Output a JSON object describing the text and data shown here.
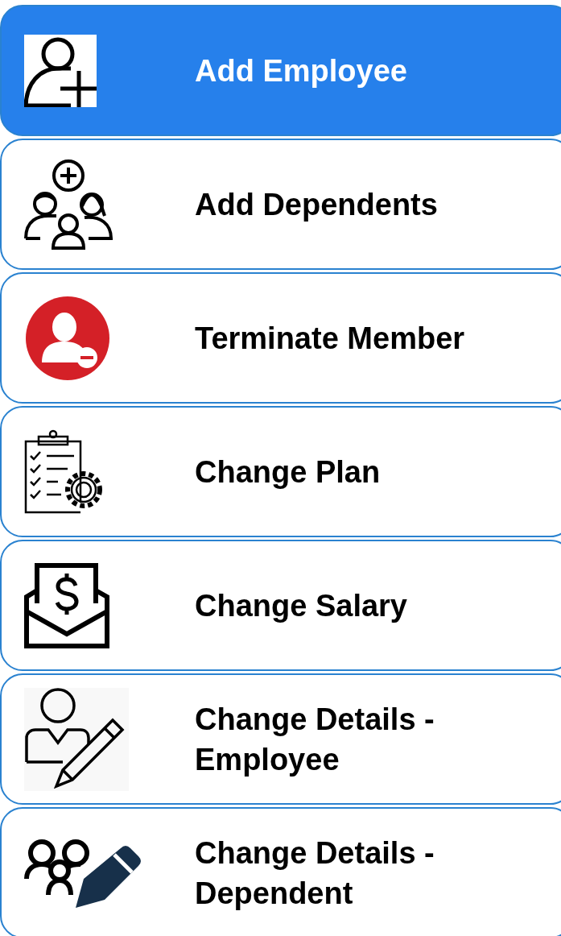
{
  "menu": [
    {
      "label": "Add Employee",
      "kind": "add-person",
      "selected": true
    },
    {
      "label": "Add Dependents",
      "kind": "add-family",
      "selected": false
    },
    {
      "label": "Terminate Member",
      "kind": "remove-person",
      "selected": false
    },
    {
      "label": "Change Plan",
      "kind": "plan",
      "selected": false
    },
    {
      "label": "Change Salary",
      "kind": "salary",
      "selected": false
    },
    {
      "label": "Change Details - Employee",
      "kind": "edit-person",
      "selected": false
    },
    {
      "label": "Change Details - Dependent",
      "kind": "edit-family",
      "selected": false
    }
  ]
}
